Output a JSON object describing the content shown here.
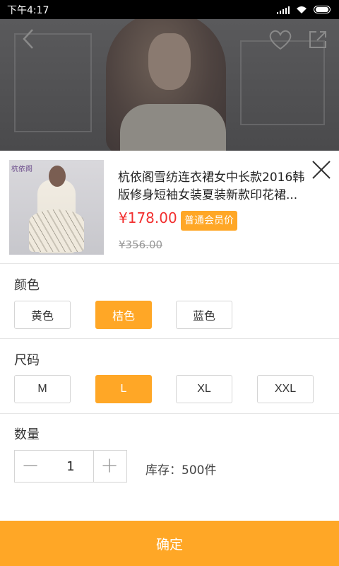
{
  "status_bar": {
    "time": "下午4:17"
  },
  "product": {
    "thumbnail_brand": "杭依阁",
    "title": "杭依阁雪纺连衣裙女中长款2016韩版修身短袖女装夏装新款印花裙...",
    "price": "¥178.00",
    "member_badge": "普通会员价",
    "original_price": "¥356.00"
  },
  "color_section": {
    "label": "颜色",
    "options": [
      "黄色",
      "桔色",
      "蓝色"
    ],
    "selected": "桔色"
  },
  "size_section": {
    "label": "尺码",
    "options": [
      "M",
      "L",
      "XL",
      "XXL"
    ],
    "selected": "L"
  },
  "quantity_section": {
    "label": "数量",
    "value": "1",
    "stock": "库存：500件"
  },
  "confirm_label": "确定",
  "colors": {
    "accent": "#ffa726",
    "price": "#f23030"
  }
}
